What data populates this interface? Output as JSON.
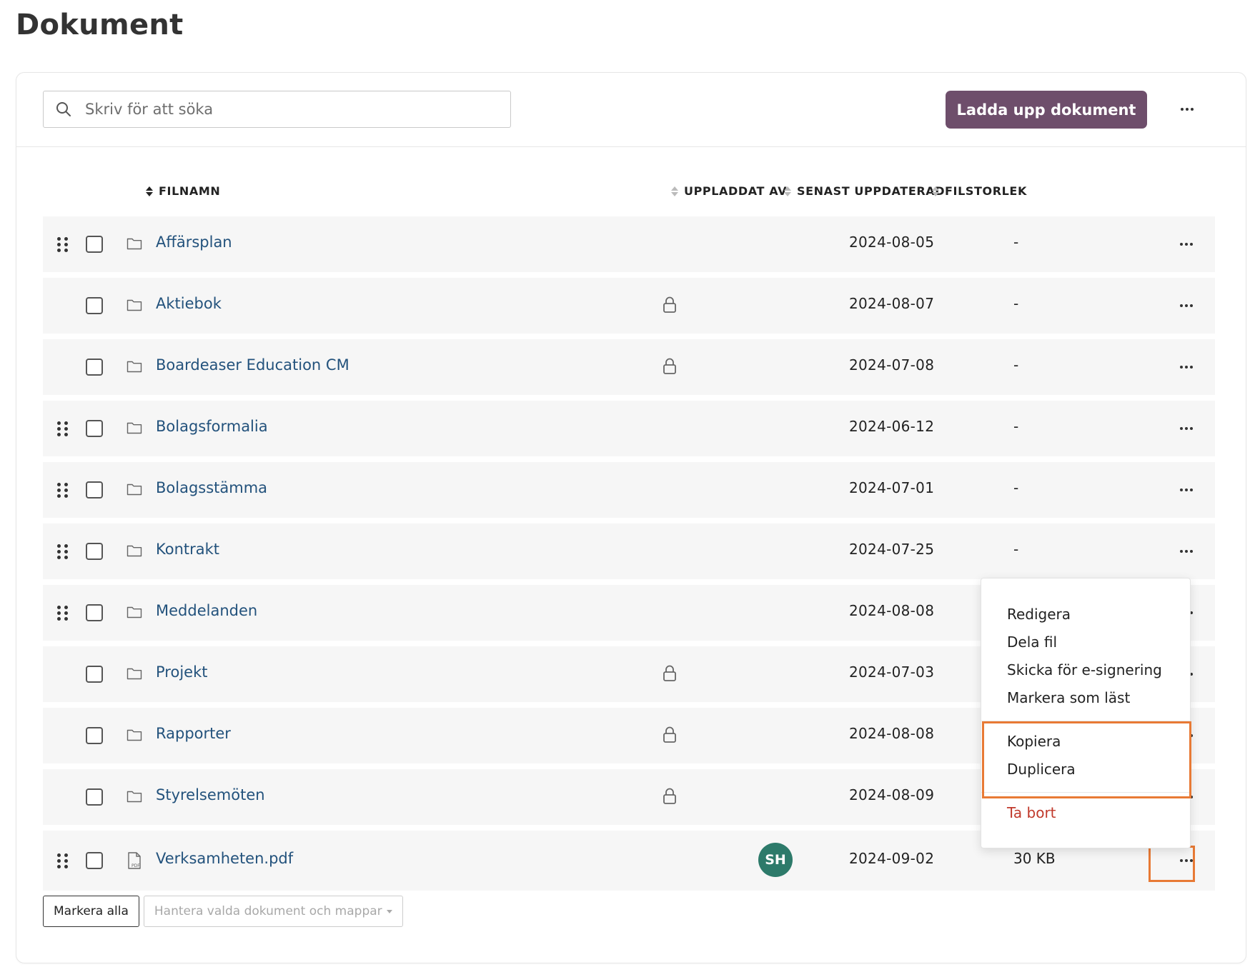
{
  "page": {
    "title": "Dokument"
  },
  "toolbar": {
    "search_placeholder": "Skriv för att söka",
    "search_value": "",
    "upload_label": "Ladda upp dokument"
  },
  "columns": {
    "filename": "FILNAMN",
    "uploaded_by": "UPPLADDAT AV",
    "last_updated": "SENAST UPPDATERAD",
    "filesize": "FILSTORLEK"
  },
  "rows": [
    {
      "name": "Affärsplan",
      "draggable": true,
      "locked": false,
      "type": "folder",
      "uploaded_by": "",
      "date": "2024-08-05",
      "size": "-"
    },
    {
      "name": "Aktiebok",
      "draggable": false,
      "locked": true,
      "type": "folder",
      "uploaded_by": "",
      "date": "2024-08-07",
      "size": "-"
    },
    {
      "name": "Boardeaser Education CM",
      "draggable": false,
      "locked": true,
      "type": "folder",
      "uploaded_by": "",
      "date": "2024-07-08",
      "size": "-"
    },
    {
      "name": "Bolagsformalia",
      "draggable": true,
      "locked": false,
      "type": "folder",
      "uploaded_by": "",
      "date": "2024-06-12",
      "size": "-"
    },
    {
      "name": "Bolagsstämma",
      "draggable": true,
      "locked": false,
      "type": "folder",
      "uploaded_by": "",
      "date": "2024-07-01",
      "size": "-"
    },
    {
      "name": "Kontrakt",
      "draggable": true,
      "locked": false,
      "type": "folder",
      "uploaded_by": "",
      "date": "2024-07-25",
      "size": "-"
    },
    {
      "name": "Meddelanden",
      "draggable": true,
      "locked": false,
      "type": "folder",
      "uploaded_by": "",
      "date": "2024-08-08",
      "size": ""
    },
    {
      "name": "Projekt",
      "draggable": false,
      "locked": true,
      "type": "folder",
      "uploaded_by": "",
      "date": "2024-07-03",
      "size": ""
    },
    {
      "name": "Rapporter",
      "draggable": false,
      "locked": true,
      "type": "folder",
      "uploaded_by": "",
      "date": "2024-08-08",
      "size": ""
    },
    {
      "name": "Styrelsemöten",
      "draggable": false,
      "locked": true,
      "type": "folder",
      "uploaded_by": "",
      "date": "2024-08-09",
      "size": ""
    },
    {
      "name": "Verksamheten.pdf",
      "draggable": true,
      "locked": false,
      "type": "pdf",
      "uploaded_by": "SH",
      "date": "2024-09-02",
      "size": "30 KB"
    }
  ],
  "context_menu": {
    "items": [
      "Redigera",
      "Dela fil",
      "Skicka för e-signering",
      "Markera som läst"
    ],
    "copy_items": [
      "Kopiera",
      "Duplicera"
    ],
    "delete": "Ta bort"
  },
  "footer": {
    "select_all": "Markera alla",
    "manage": "Hantera valda dokument och mappar"
  },
  "colors": {
    "accent": "#6e4e6b",
    "link": "#23527c",
    "highlight": "#e87a35",
    "danger": "#c0392b",
    "avatar": "#2d7a6a"
  },
  "icons": {
    "search": "search-icon",
    "folder": "folder-icon",
    "pdf": "pdf-file-icon",
    "lock": "lock-icon",
    "drag": "drag-handle-icon",
    "more": "more-options-icon"
  }
}
